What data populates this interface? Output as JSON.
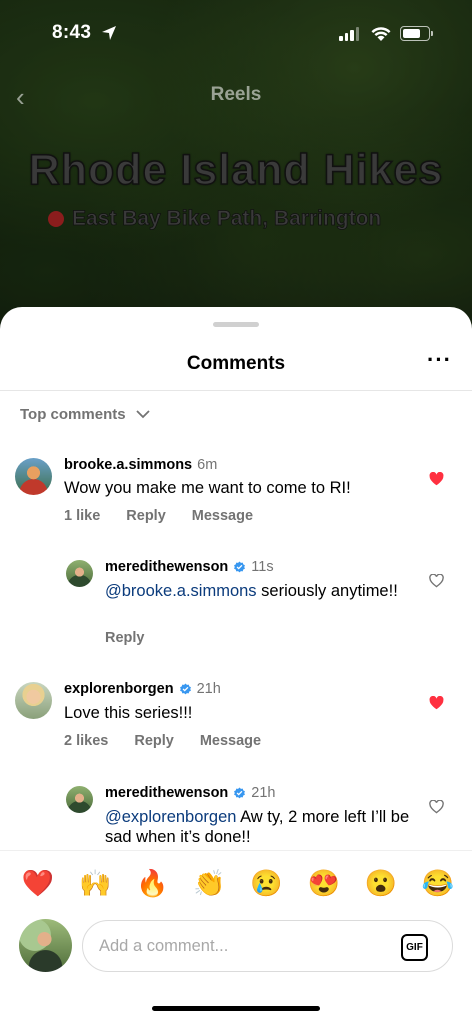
{
  "status_bar": {
    "time": "8:43"
  },
  "header": {
    "title": "Reels"
  },
  "video": {
    "title": "Rhode Island Hikes",
    "location": "East Bay Bike Path, Barrington"
  },
  "sheet": {
    "title": "Comments",
    "sort_label": "Top comments"
  },
  "comments": [
    {
      "username": "brooke.a.simmons",
      "time": "6m",
      "text": "Wow you make me want to come to RI!",
      "likes": "1 like",
      "reply": "Reply",
      "message": "Message",
      "liked": true
    },
    {
      "username": "meredithewenson",
      "time": "11s",
      "mention": "@brooke.a.simmons",
      "text": " seriously anytime!!",
      "reply": "Reply",
      "liked": false,
      "verified": true
    },
    {
      "username": "explorenborgen",
      "time": "21h",
      "text": "Love this series!!!",
      "likes": "2 likes",
      "reply": "Reply",
      "message": "Message",
      "liked": true,
      "verified": true
    },
    {
      "username": "meredithewenson",
      "time": "21h",
      "mention": "@explorenborgen",
      "text": " Aw ty, 2 more left I’ll be sad when it’s done!!",
      "liked": false,
      "verified": true
    }
  ],
  "emojis": [
    "❤️",
    "🙌",
    "🔥",
    "👏",
    "😢",
    "😍",
    "😮",
    "😂"
  ],
  "composer": {
    "placeholder": "Add a comment...",
    "gif_label": "GIF"
  },
  "colors": {
    "like_red": "#ff3040",
    "verified_blue": "#3897f0",
    "mention_blue": "#0b3b7c"
  }
}
